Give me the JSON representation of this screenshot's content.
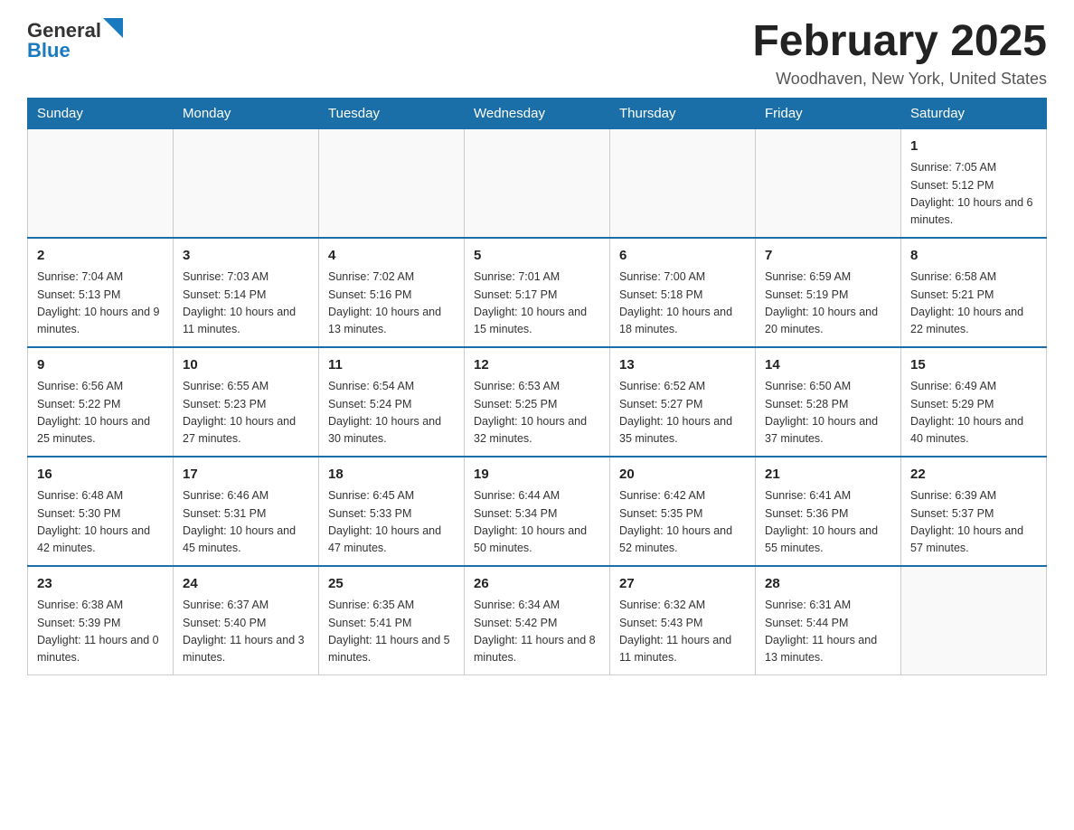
{
  "header": {
    "logo_general": "General",
    "logo_blue": "Blue",
    "title": "February 2025",
    "subtitle": "Woodhaven, New York, United States"
  },
  "weekdays": [
    "Sunday",
    "Monday",
    "Tuesday",
    "Wednesday",
    "Thursday",
    "Friday",
    "Saturday"
  ],
  "weeks": [
    [
      {
        "day": "",
        "info": ""
      },
      {
        "day": "",
        "info": ""
      },
      {
        "day": "",
        "info": ""
      },
      {
        "day": "",
        "info": ""
      },
      {
        "day": "",
        "info": ""
      },
      {
        "day": "",
        "info": ""
      },
      {
        "day": "1",
        "info": "Sunrise: 7:05 AM\nSunset: 5:12 PM\nDaylight: 10 hours and 6 minutes."
      }
    ],
    [
      {
        "day": "2",
        "info": "Sunrise: 7:04 AM\nSunset: 5:13 PM\nDaylight: 10 hours and 9 minutes."
      },
      {
        "day": "3",
        "info": "Sunrise: 7:03 AM\nSunset: 5:14 PM\nDaylight: 10 hours and 11 minutes."
      },
      {
        "day": "4",
        "info": "Sunrise: 7:02 AM\nSunset: 5:16 PM\nDaylight: 10 hours and 13 minutes."
      },
      {
        "day": "5",
        "info": "Sunrise: 7:01 AM\nSunset: 5:17 PM\nDaylight: 10 hours and 15 minutes."
      },
      {
        "day": "6",
        "info": "Sunrise: 7:00 AM\nSunset: 5:18 PM\nDaylight: 10 hours and 18 minutes."
      },
      {
        "day": "7",
        "info": "Sunrise: 6:59 AM\nSunset: 5:19 PM\nDaylight: 10 hours and 20 minutes."
      },
      {
        "day": "8",
        "info": "Sunrise: 6:58 AM\nSunset: 5:21 PM\nDaylight: 10 hours and 22 minutes."
      }
    ],
    [
      {
        "day": "9",
        "info": "Sunrise: 6:56 AM\nSunset: 5:22 PM\nDaylight: 10 hours and 25 minutes."
      },
      {
        "day": "10",
        "info": "Sunrise: 6:55 AM\nSunset: 5:23 PM\nDaylight: 10 hours and 27 minutes."
      },
      {
        "day": "11",
        "info": "Sunrise: 6:54 AM\nSunset: 5:24 PM\nDaylight: 10 hours and 30 minutes."
      },
      {
        "day": "12",
        "info": "Sunrise: 6:53 AM\nSunset: 5:25 PM\nDaylight: 10 hours and 32 minutes."
      },
      {
        "day": "13",
        "info": "Sunrise: 6:52 AM\nSunset: 5:27 PM\nDaylight: 10 hours and 35 minutes."
      },
      {
        "day": "14",
        "info": "Sunrise: 6:50 AM\nSunset: 5:28 PM\nDaylight: 10 hours and 37 minutes."
      },
      {
        "day": "15",
        "info": "Sunrise: 6:49 AM\nSunset: 5:29 PM\nDaylight: 10 hours and 40 minutes."
      }
    ],
    [
      {
        "day": "16",
        "info": "Sunrise: 6:48 AM\nSunset: 5:30 PM\nDaylight: 10 hours and 42 minutes."
      },
      {
        "day": "17",
        "info": "Sunrise: 6:46 AM\nSunset: 5:31 PM\nDaylight: 10 hours and 45 minutes."
      },
      {
        "day": "18",
        "info": "Sunrise: 6:45 AM\nSunset: 5:33 PM\nDaylight: 10 hours and 47 minutes."
      },
      {
        "day": "19",
        "info": "Sunrise: 6:44 AM\nSunset: 5:34 PM\nDaylight: 10 hours and 50 minutes."
      },
      {
        "day": "20",
        "info": "Sunrise: 6:42 AM\nSunset: 5:35 PM\nDaylight: 10 hours and 52 minutes."
      },
      {
        "day": "21",
        "info": "Sunrise: 6:41 AM\nSunset: 5:36 PM\nDaylight: 10 hours and 55 minutes."
      },
      {
        "day": "22",
        "info": "Sunrise: 6:39 AM\nSunset: 5:37 PM\nDaylight: 10 hours and 57 minutes."
      }
    ],
    [
      {
        "day": "23",
        "info": "Sunrise: 6:38 AM\nSunset: 5:39 PM\nDaylight: 11 hours and 0 minutes."
      },
      {
        "day": "24",
        "info": "Sunrise: 6:37 AM\nSunset: 5:40 PM\nDaylight: 11 hours and 3 minutes."
      },
      {
        "day": "25",
        "info": "Sunrise: 6:35 AM\nSunset: 5:41 PM\nDaylight: 11 hours and 5 minutes."
      },
      {
        "day": "26",
        "info": "Sunrise: 6:34 AM\nSunset: 5:42 PM\nDaylight: 11 hours and 8 minutes."
      },
      {
        "day": "27",
        "info": "Sunrise: 6:32 AM\nSunset: 5:43 PM\nDaylight: 11 hours and 11 minutes."
      },
      {
        "day": "28",
        "info": "Sunrise: 6:31 AM\nSunset: 5:44 PM\nDaylight: 11 hours and 13 minutes."
      },
      {
        "day": "",
        "info": ""
      }
    ]
  ]
}
